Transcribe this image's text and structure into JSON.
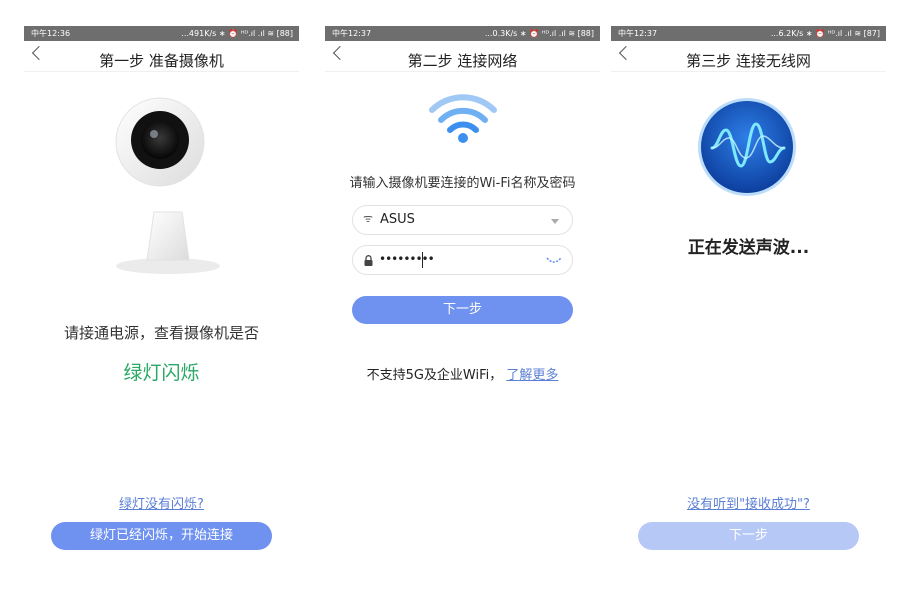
{
  "screens": [
    {
      "status": {
        "time": "中午12:36",
        "right": "...491K/s ∗ ⏰ ᴴᴰ.ıl .ıl ≋ [88]"
      },
      "title": "第一步 准备摄像机",
      "instruction": "请接通电源，查看摄像机是否",
      "highlight": "绿灯闪烁",
      "help_link": "绿灯没有闪烁?",
      "button": "绿灯已经闪烁，开始连接"
    },
    {
      "status": {
        "time": "中午12:37",
        "right": "...0.3K/s ∗ ⏰ ᴴᴰ.ıl .ıl ≋ [88]"
      },
      "title": "第二步 连接网络",
      "instruction": "请输入摄像机要连接的Wi-Fi名称及密码",
      "ssid_value": "ASUS",
      "password_value": "•••••••••",
      "button": "下一步",
      "note_text": "不支持5G及企业WiFi，",
      "note_link": "了解更多"
    },
    {
      "status": {
        "time": "中午12:37",
        "right": "...6.2K/s ∗ ⏰ ᴴᴰ.ıl .ıl ≋ [87]"
      },
      "title": "第三步 连接无线网",
      "sending": "正在发送声波...",
      "help_link": "没有听到\"接收成功\"?",
      "button": "下一步"
    }
  ],
  "colors": {
    "status_bar": "#6e6e6e",
    "primary_button": "#6f91f0",
    "disabled_button": "#b6c8f6",
    "link": "#5b7fd6",
    "green": "#2aa865"
  },
  "icons": [
    "chevron-left-icon",
    "camera-illustration",
    "wifi-icon",
    "lock-icon",
    "chevron-down-icon",
    "loading-icon",
    "sound-wave-icon"
  ]
}
